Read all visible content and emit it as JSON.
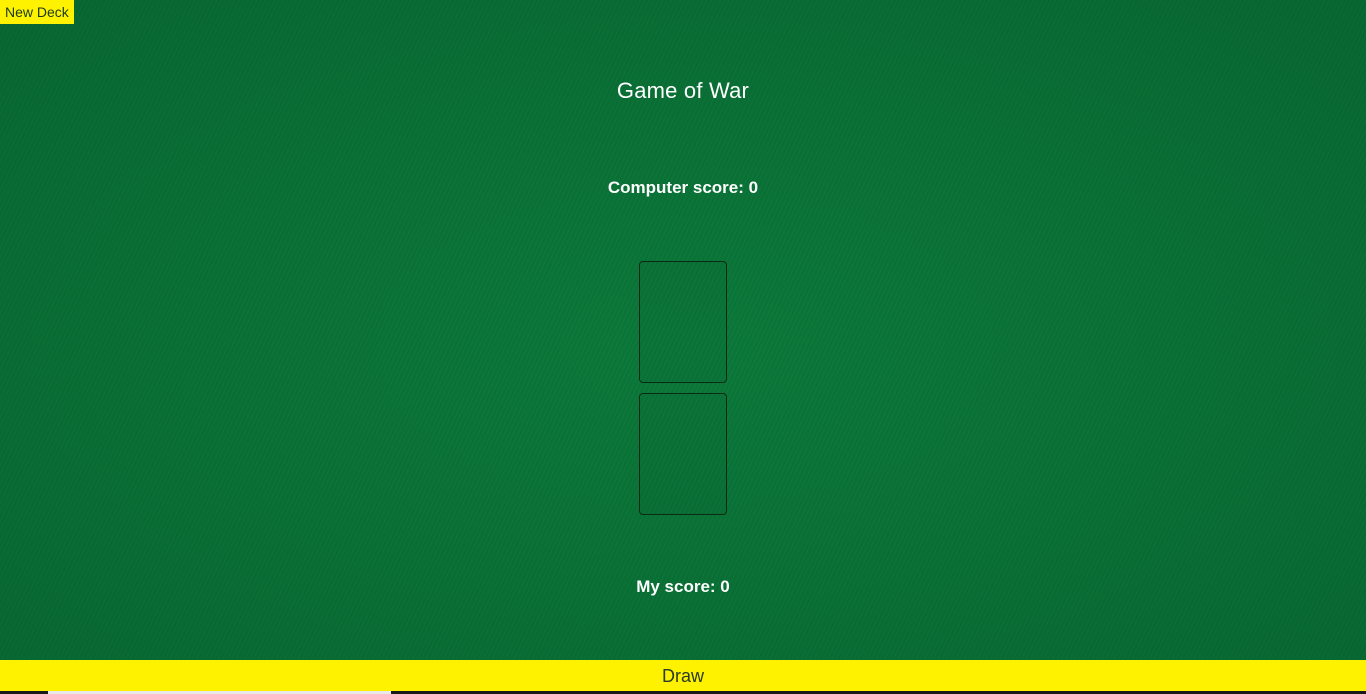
{
  "header": {
    "new_deck_label": "New Deck"
  },
  "game": {
    "title": "Game of War",
    "computer_score_text": "Computer score: 0",
    "my_score_text": "My score: 0"
  },
  "controls": {
    "draw_label": "Draw"
  },
  "colors": {
    "table_felt": "#0a7a3a",
    "button_yellow": "#fff200",
    "text": "#ffffff"
  }
}
